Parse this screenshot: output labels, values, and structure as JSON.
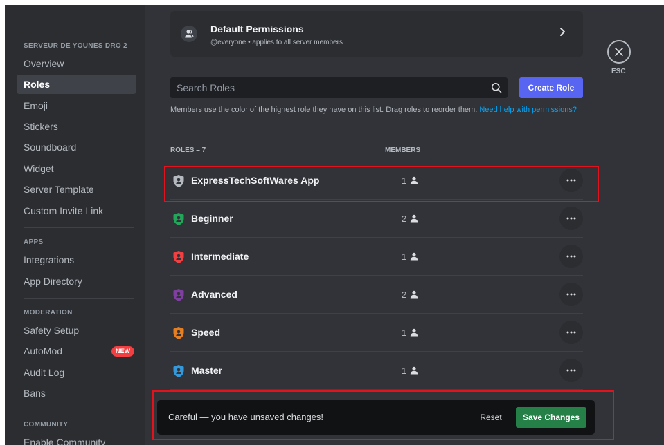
{
  "sidebar": {
    "server_header": "SERVEUR DE YOUNES DRO 2",
    "server_items": [
      "Overview",
      "Roles",
      "Emoji",
      "Stickers",
      "Soundboard",
      "Widget",
      "Server Template",
      "Custom Invite Link"
    ],
    "active_item": "Roles",
    "apps_header": "APPS",
    "apps_items": [
      "Integrations",
      "App Directory"
    ],
    "moderation_header": "MODERATION",
    "moderation_items": [
      "Safety Setup",
      "AutoMod",
      "Audit Log",
      "Bans"
    ],
    "automod_badge": "NEW",
    "community_header": "COMMUNITY",
    "community_items": [
      "Enable Community"
    ]
  },
  "default_permissions": {
    "title": "Default Permissions",
    "subtitle": "@everyone • applies to all server members"
  },
  "search": {
    "placeholder": "Search Roles"
  },
  "create_role_label": "Create Role",
  "description": {
    "text": "Members use the color of the highest role they have on this list. Drag roles to reorder them. ",
    "link": "Need help with permissions?"
  },
  "columns": {
    "roles": "ROLES – 7",
    "members": "MEMBERS"
  },
  "roles": [
    {
      "name": "ExpressTechSoftWares App",
      "members": "1",
      "color": "#b5bac1"
    },
    {
      "name": "Beginner",
      "members": "2",
      "color": "#23a55a"
    },
    {
      "name": "Intermediate",
      "members": "1",
      "color": "#f23f42"
    },
    {
      "name": "Advanced",
      "members": "2",
      "color": "#7e3fa0"
    },
    {
      "name": "Speed",
      "members": "1",
      "color": "#e67e22"
    },
    {
      "name": "Master",
      "members": "1",
      "color": "#3498db"
    }
  ],
  "close": {
    "label": "ESC"
  },
  "unsaved": {
    "message": "Careful — you have unsaved changes!",
    "reset_label": "Reset",
    "save_label": "Save Changes"
  },
  "colors": {
    "accent": "#5865f2",
    "save": "#248046",
    "danger": "#f23f42",
    "highlight": "#e3121c"
  }
}
